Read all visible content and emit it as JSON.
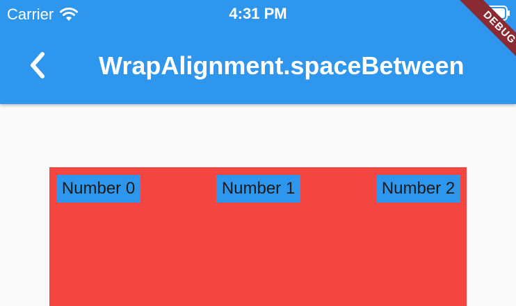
{
  "status_bar": {
    "carrier": "Carrier",
    "time": "4:31 PM"
  },
  "app_bar": {
    "title": "WrapAlignment.spaceBetween",
    "back_icon": "chevron-left-icon"
  },
  "debug_banner": {
    "label": "DEBUG"
  },
  "wrap": {
    "items": [
      {
        "label": "Number 0"
      },
      {
        "label": "Number 1"
      },
      {
        "label": "Number 2"
      }
    ]
  },
  "colors": {
    "app_bar": "#2E97ED",
    "container": "#F34641",
    "chip": "#2E97ED",
    "debug": "#8A2B33",
    "background": "#FAFAFA"
  }
}
